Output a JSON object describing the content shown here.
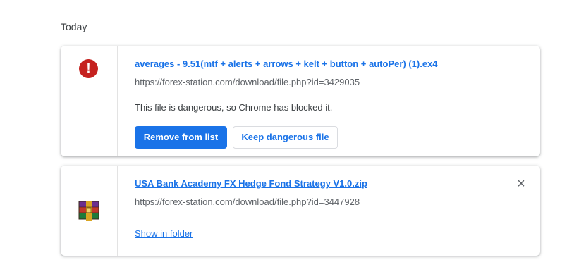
{
  "section": {
    "date_label": "Today"
  },
  "downloads": [
    {
      "filename": "averages - 9.51(mtf + alerts + arrows + kelt + button + autoPer) (1).ex4",
      "url": "https://forex-station.com/download/file.php?id=3429035",
      "warning": "This file is dangerous, so Chrome has blocked it.",
      "primary_button": "Remove from list",
      "secondary_button": "Keep dangerous file",
      "icon": "danger-icon",
      "icon_glyph": "!",
      "accent_color": "#c5221f"
    },
    {
      "filename": "USA Bank Academy FX Hedge Fond Strategy V1.0.zip",
      "url": "https://forex-station.com/download/file.php?id=3447928",
      "link": "Show in folder",
      "icon": "winrar-archive-icon",
      "close_glyph": "×"
    }
  ],
  "colors": {
    "link": "#1a73e8",
    "danger": "#c5221f",
    "secondary_text": "#5f6368"
  }
}
